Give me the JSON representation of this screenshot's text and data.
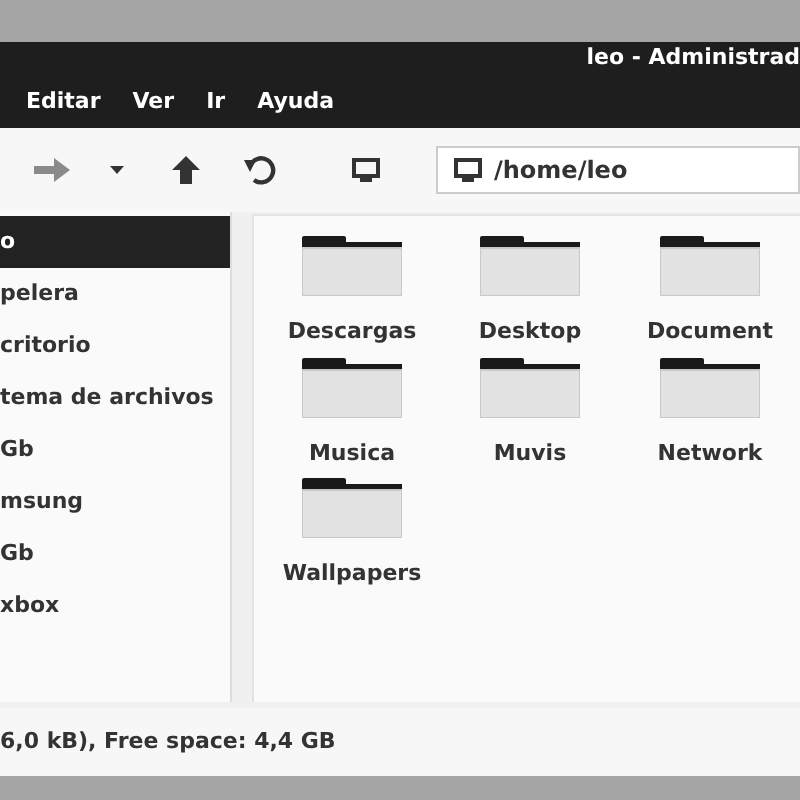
{
  "window": {
    "title": "leo - Administrad"
  },
  "menu": [
    "Editar",
    "Ver",
    "Ir",
    "Ayuda"
  ],
  "toolbar": {
    "path": "/home/leo"
  },
  "sidebar": {
    "items": [
      {
        "label": "o",
        "selected": true
      },
      {
        "label": "pelera",
        "selected": false
      },
      {
        "label": "critorio",
        "selected": false
      },
      {
        "label": "tema de archivos",
        "selected": false
      },
      {
        "label": "Gb",
        "selected": false
      },
      {
        "label": "msung",
        "selected": false
      },
      {
        "label": "Gb",
        "selected": false
      },
      {
        "label": "xbox",
        "selected": false
      }
    ]
  },
  "folders": [
    "Descargas",
    "Desktop",
    "Document",
    "Musica",
    "Muvis",
    "Network",
    "Wallpapers"
  ],
  "status_bar": "6,0 kB), Free space: 4,4 GB"
}
